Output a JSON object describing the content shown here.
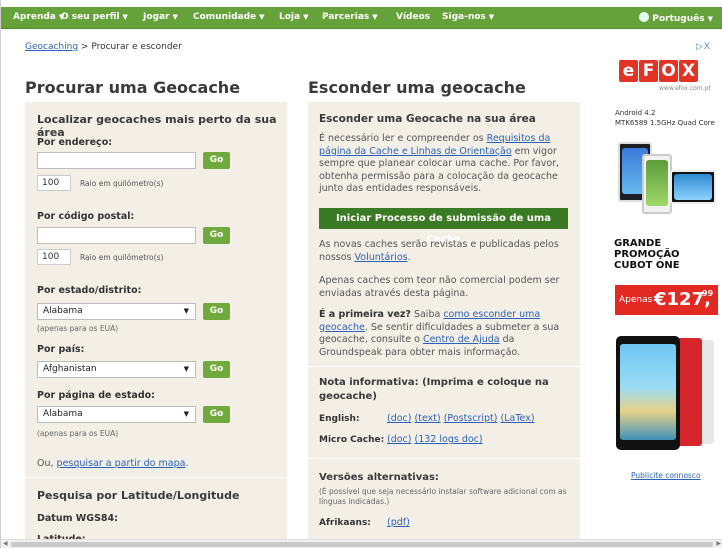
{
  "nav": {
    "items": [
      {
        "label": "Aprenda"
      },
      {
        "label": "O seu perfil"
      },
      {
        "label": "Jogar"
      },
      {
        "label": "Comunidade"
      },
      {
        "label": "Loja"
      },
      {
        "label": "Parcerias"
      },
      {
        "label": "Vídeos"
      },
      {
        "label": "Siga-nos"
      }
    ],
    "caret": "▼",
    "language": "Português",
    "language_caret": "▼"
  },
  "breadcrumb": {
    "link": "Geocaching",
    "separator": " > ",
    "current": "Procurar e esconder"
  },
  "left": {
    "heading": "Procurar uma Geocache",
    "find_title": "Localizar geocaches mais perto da sua área",
    "by_address": "Por endereço:",
    "by_postal": "Por código postal:",
    "radius_value_1": "100",
    "radius_value_2": "100",
    "radius_label": "Raio em quilómetro(s)",
    "go": "Go",
    "by_state": "Por estado/distrito:",
    "state_value": "Alabama",
    "usa_only": "(apenas para os EUA)",
    "by_country": "Por país:",
    "country_value": "Afghanistan",
    "by_state_page": "Por página de estado:",
    "state_page_value": "Alabama",
    "usa_only_2": "(apenas para os EUA)",
    "or_prefix": "Ou, ",
    "map_link": "pesquisar a partir do mapa",
    "map_suffix": ".",
    "latlon_title": "Pesquisa por Latitude/Longitude",
    "datum": "Datum WGS84:",
    "latitude": "Latitude:"
  },
  "right": {
    "heading": "Esconder uma geocache",
    "hide_title": "Esconder uma Geocache na sua área",
    "p1_a": "É necessário ler e compreender os ",
    "p1_link": "Requisitos da página da Cache e Linhas de Orientação",
    "p1_b": " em vigor sempre que planear colocar uma cache. Por favor, obtenha permissão para a colocação da geocache junto das entidades responsáveis.",
    "start_button": "Iniciar Processo de submissão de uma Cache",
    "p2_a": "As novas caches serão revistas e publicadas pelos nossos ",
    "p2_link": "Voluntários",
    "p2_b": ".",
    "p3": "Apenas caches com teor não comercial podem ser enviadas através desta página.",
    "p4_bold": "É a primeira vez?",
    "p4_a": " Saiba ",
    "p4_link": "como esconder uma geocache",
    "p4_b": ". Se sentir dificuldades a submeter a sua geocache, consulte o ",
    "p4_link2": "Centro de Ajuda",
    "p4_c": " da Groundspeak para obter mais informação.",
    "note_title": "Nota informativa: (Imprima e coloque na geocache)",
    "english_label": "English:",
    "english_links": [
      "(doc)",
      "(text)",
      "(Postscript)",
      "(LaTex)"
    ],
    "micro_label": "Micro Cache:",
    "micro_links": [
      "(doc)",
      "(132 logs doc)"
    ],
    "alt_title": "Versões alternativas:",
    "alt_note": "(É possível que seja necessário instalar software adicional com as línguas indicadas.)",
    "afrikaans_label": "Afrikaans:",
    "afrikaans_link": "(pdf)"
  },
  "ad": {
    "adchoices": "▷X",
    "brand_letters": [
      "e",
      "F",
      "O",
      "X"
    ],
    "brand_url": "www.efox.com.pt",
    "line1": "Android 4.2",
    "line2": "MTK6589 1.5GHz Quad Core",
    "promo_line1": "GRANDE PROMOÇÃO",
    "promo_line2": "CUBOT ONE",
    "price_prefix": "Apenas",
    "price_value": "€127,",
    "price_cents": "99",
    "publicite": "Publicite connosco"
  },
  "colors": {
    "nav": "#65a33a",
    "panel": "#f4efe6",
    "button": "#70aa3d",
    "start_button": "#3b7a24",
    "link": "#2a62b8",
    "price": "#e32a22"
  }
}
